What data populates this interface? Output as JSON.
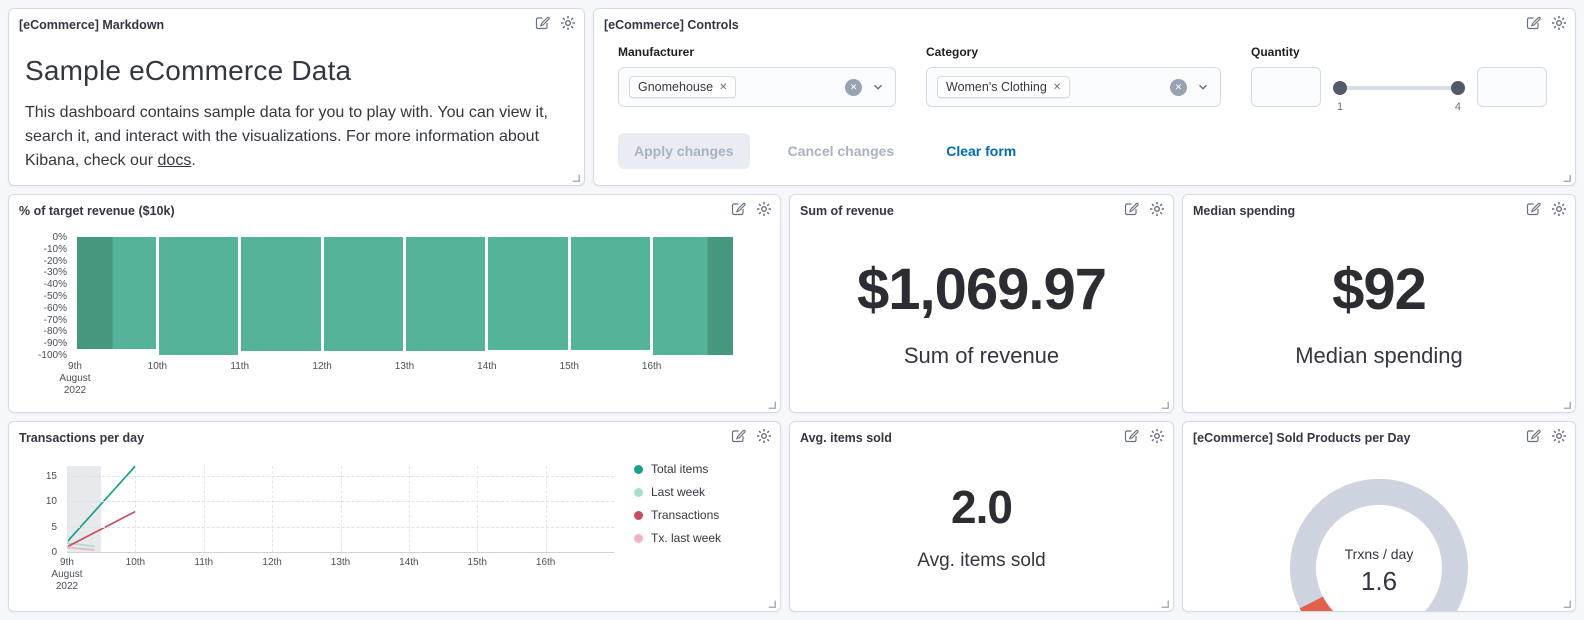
{
  "panels": {
    "markdown": {
      "header": "[eCommerce] Markdown",
      "title": "Sample eCommerce Data",
      "body": "This dashboard contains sample data for you to play with. You can view it, search it, and interact with the visualizations. For more information about Kibana, check our ",
      "docs_link_label": "docs",
      "body_suffix": "."
    },
    "controls": {
      "header": "[eCommerce] Controls",
      "manufacturer": {
        "label": "Manufacturer",
        "selected": "Gnomehouse"
      },
      "category": {
        "label": "Category",
        "selected": "Women's Clothing"
      },
      "quantity": {
        "label": "Quantity",
        "min": "1",
        "max": "4"
      },
      "buttons": {
        "apply": "Apply changes",
        "cancel": "Cancel changes",
        "clear": "Clear form"
      }
    },
    "target_revenue": {
      "header": "% of target revenue ($10k)"
    },
    "sum_of_revenue": {
      "header": "Sum of revenue",
      "value": "$1,069.97",
      "label": "Sum of revenue"
    },
    "median_spending": {
      "header": "Median spending",
      "value": "$92",
      "label": "Median spending"
    },
    "transactions_per_day": {
      "header": "Transactions per day"
    },
    "avg_items_sold": {
      "header": "Avg. items sold",
      "value": "2.0",
      "label": "Avg. items sold"
    },
    "sold_products_per_day": {
      "header": "[eCommerce] Sold Products per Day",
      "gauge_label": "Trxns / day",
      "gauge_value": "1.6"
    }
  },
  "chart_data": [
    {
      "id": "target-revenue-bars",
      "type": "bar",
      "title": "% of target revenue ($10k)",
      "categories": [
        "9th\nAugust\n2022",
        "10th",
        "11th",
        "12th",
        "13th",
        "14th",
        "15th",
        "16th"
      ],
      "values": [
        -95,
        -100,
        -97,
        -97,
        -97,
        -96,
        -96,
        -100
      ],
      "ylim": [
        -100,
        0
      ],
      "yticks": [
        "0%",
        "-10%",
        "-20%",
        "-30%",
        "-40%",
        "-50%",
        "-60%",
        "-70%",
        "-80%",
        "-90%",
        "-100%"
      ],
      "bar_color": "#54B399",
      "bar_color_highlight": "#459780",
      "grid": false
    },
    {
      "id": "transactions-lines",
      "type": "line",
      "title": "Transactions per day",
      "categories": [
        "9th\nAugust\n2022",
        "10th",
        "11th",
        "12th",
        "13th",
        "14th",
        "15th",
        "16th"
      ],
      "ylim": [
        0,
        17
      ],
      "yticks": [
        0,
        5,
        10,
        15
      ],
      "grid": true,
      "legend_position": "right",
      "series": [
        {
          "name": "Total items",
          "color": "#1BA088",
          "x": [
            0,
            1
          ],
          "values": [
            2,
            17
          ]
        },
        {
          "name": "Last week",
          "color": "#ABDED0",
          "x": [
            0,
            0.4
          ],
          "values": [
            1.8,
            1.1
          ]
        },
        {
          "name": "Transactions",
          "color": "#C84E5F",
          "x": [
            0,
            1
          ],
          "values": [
            1,
            8
          ]
        },
        {
          "name": "Tx. last week",
          "color": "#F1B3C1",
          "x": [
            0,
            0.4
          ],
          "values": [
            0.9,
            0.4
          ]
        }
      ]
    },
    {
      "id": "trxns-gauge",
      "type": "gauge",
      "label": "Trxns / day",
      "value": 1.6,
      "display": "1.6",
      "min": 0,
      "max": 24,
      "track_color": "#CDD3DF",
      "value_color": "#E4604E"
    }
  ]
}
